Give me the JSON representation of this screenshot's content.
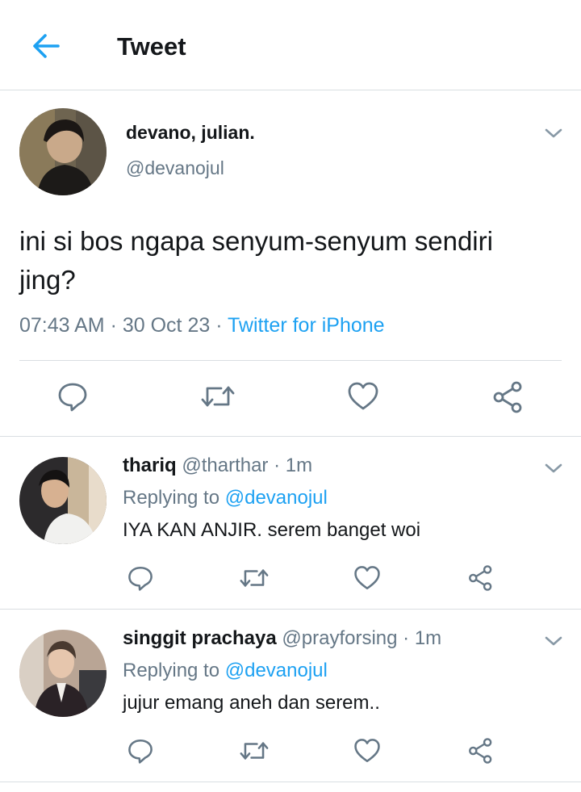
{
  "header": {
    "title": "Tweet",
    "back_icon": "arrow-left-icon",
    "accent": "#1da1f2"
  },
  "main_tweet": {
    "name": "devano, julian.",
    "handle": "@devanojul",
    "text": "ini si bos ngapa senyum-senyum sendiri jing?",
    "time": "07:43 AM",
    "separator": " · ",
    "date": "30 Oct 23",
    "source": "Twitter for iPhone",
    "actions": [
      "reply-icon",
      "retweet-icon",
      "like-icon",
      "share-icon"
    ]
  },
  "replies": [
    {
      "name": "thariq",
      "handle": "@tharthar",
      "time": " · 1m",
      "replying_prefix": "Replying to ",
      "replying_to": "@devanojul",
      "text": "IYA KAN ANJIR. serem banget woi"
    },
    {
      "name": "singgit prachaya",
      "handle": "@prayforsing",
      "time": " · 1m",
      "replying_prefix": "Replying to ",
      "replying_to": "@devanojul",
      "text": "jujur emang aneh dan serem.."
    }
  ],
  "colors": {
    "text": "#14171a",
    "secondary": "#657786",
    "link": "#1da1f2",
    "divider": "#d9dee2"
  }
}
